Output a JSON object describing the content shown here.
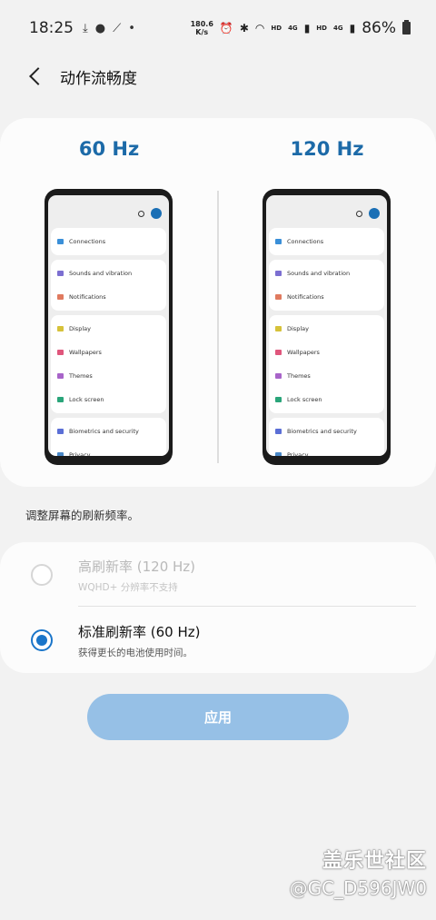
{
  "status_bar": {
    "time": "18:25",
    "net_speed_top": "180.6",
    "net_speed_bottom": "K/s",
    "hd1": "HD",
    "net1": "4G",
    "hd2": "HD",
    "net2": "4G",
    "battery": "86%"
  },
  "header": {
    "title": "动作流畅度"
  },
  "preview": {
    "left_label": "60 Hz",
    "right_label": "120 Hz",
    "menu_groups": [
      [
        {
          "label": "Connections",
          "icon_color": "#3a8fd8"
        }
      ],
      [
        {
          "label": "Sounds and vibration",
          "icon_color": "#7c6fd1"
        },
        {
          "label": "Notifications",
          "icon_color": "#e07a5f"
        }
      ],
      [
        {
          "label": "Display",
          "icon_color": "#d6c23a"
        },
        {
          "label": "Wallpapers",
          "icon_color": "#e0567c"
        },
        {
          "label": "Themes",
          "icon_color": "#a864c9"
        },
        {
          "label": "Lock screen",
          "icon_color": "#2aa57a"
        }
      ],
      [
        {
          "label": "Biometrics and security",
          "icon_color": "#5b6fd6"
        },
        {
          "label": "Privacy",
          "icon_color": "#4a88c7"
        }
      ]
    ]
  },
  "hint": "调整屏幕的刷新频率。",
  "options": [
    {
      "title": "高刷新率 (120 Hz)",
      "subtitle": "WQHD+ 分辨率不支持",
      "selected": false,
      "enabled": false
    },
    {
      "title": "标准刷新率 (60 Hz)",
      "subtitle": "获得更长的电池使用时间。",
      "selected": true,
      "enabled": true
    }
  ],
  "apply_label": "应用",
  "watermark": {
    "line1": "盖乐世社区",
    "line2": "@GC_D596JW0"
  },
  "colors": {
    "accent": "#1a75c9",
    "hz_label": "#1c6aa8",
    "button_disabled": "#96c0e6"
  }
}
